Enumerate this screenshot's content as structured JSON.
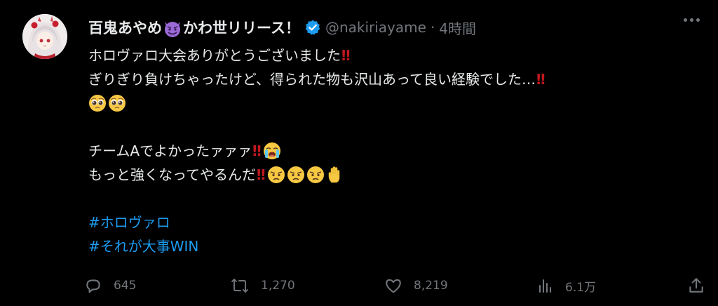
{
  "tweet": {
    "display_name": "百鬼あやめ",
    "display_name_emoji": "smiling-devil-emoji",
    "display_name_suffix": "かわ世リリース！",
    "verified_icon": "verified-badge-icon",
    "handle": "@nakiriayame",
    "dot": "·",
    "timestamp": "4時間",
    "body": {
      "line1": "ホロヴァロ大会ありがとうございました",
      "line2": "ぎりぎり負けちゃったけど、得られた物も沢山あって良い経験でした…",
      "line4": "チームAでよかったァァァ",
      "line5": "もっと強くなってやるんだ",
      "hashtag1": "#ホロヴァロ",
      "hashtag2": "#それが大事WIN"
    },
    "emojis": {
      "bang": "‼",
      "pleading": "pleading-face-emoji",
      "crying": "loudly-crying-face-emoji",
      "angry": "angry-face-emoji",
      "hand": "raised-hand-emoji"
    },
    "hashtag_color": "#1d9bf0",
    "bang_color": "#c0181e"
  },
  "actions": {
    "reply_count": "645",
    "retweet_count": "1,270",
    "like_count": "8,219",
    "views_count": "6.1万",
    "icons": [
      "reply-icon",
      "retweet-icon",
      "like-icon",
      "views-icon",
      "share-icon"
    ]
  }
}
